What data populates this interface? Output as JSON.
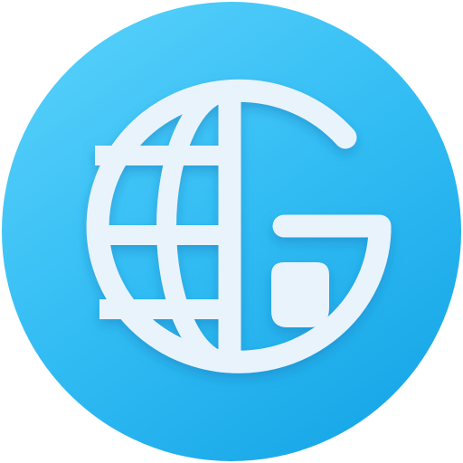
{
  "icon": {
    "name": "globe-g-app-icon",
    "colors": {
      "background_light": "#5DD3FB",
      "background_mid": "#33BDF4",
      "background_dark": "#19A8E8",
      "glyph": "#E9F3FB",
      "glyph_shadow": "#1C86C4"
    }
  }
}
